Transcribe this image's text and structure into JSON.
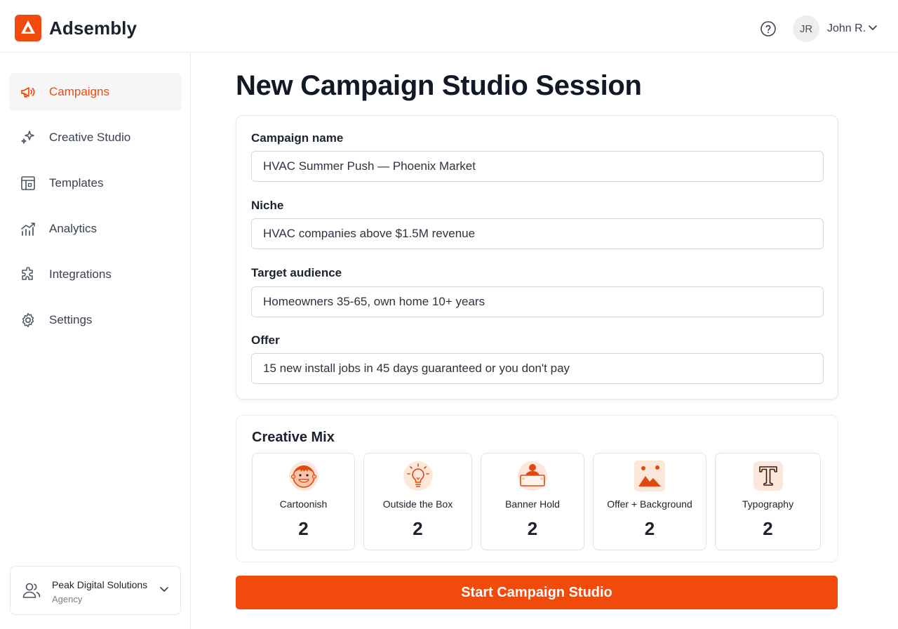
{
  "header": {
    "brand": "Adsembly",
    "user_initials": "JR",
    "user_name": "John R."
  },
  "sidebar": {
    "items": [
      {
        "label": "Campaigns",
        "icon": "megaphone-icon",
        "active": true
      },
      {
        "label": "Creative Studio",
        "icon": "sparkles-icon"
      },
      {
        "label": "Templates",
        "icon": "template-icon"
      },
      {
        "label": "Analytics",
        "icon": "chart-icon"
      },
      {
        "label": "Integrations",
        "icon": "puzzle-icon"
      },
      {
        "label": "Settings",
        "icon": "gear-icon"
      }
    ],
    "org": {
      "name": "Peak Digital Solutions",
      "type": "Agency"
    }
  },
  "main": {
    "title": "New Campaign Studio Session",
    "fields": [
      {
        "label": "Campaign name",
        "value": "HVAC Summer Push — Phoenix Market"
      },
      {
        "label": "Niche",
        "value": "HVAC companies above $1.5M revenue"
      },
      {
        "label": "Target audience",
        "value": "Homeowners 35-65, own home 10+ years"
      },
      {
        "label": "Offer",
        "value": "15 new install jobs in 45 days guaranteed or you don't pay"
      }
    ],
    "mix": {
      "title": "Creative Mix",
      "tiles": [
        {
          "label": "Cartoonish",
          "count": "2",
          "icon": "cartoon-face-icon"
        },
        {
          "label": "Outside the Box",
          "count": "2",
          "icon": "lightbulb-icon"
        },
        {
          "label": "Banner Hold",
          "count": "2",
          "icon": "person-banner-icon"
        },
        {
          "label": "Offer + Background",
          "count": "2",
          "icon": "landscape-image-icon"
        },
        {
          "label": "Typography",
          "count": "2",
          "icon": "typography-icon"
        }
      ]
    },
    "cta": "Start Campaign Studio"
  },
  "colors": {
    "accent": "#f04a0c",
    "tile_icon_bg": "#fde6da"
  }
}
